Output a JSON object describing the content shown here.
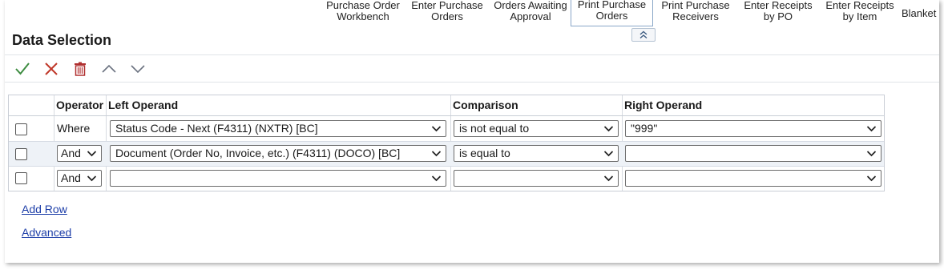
{
  "tabs": [
    {
      "label_line1": "Purchase Order",
      "label_line2": "Workbench",
      "active": false
    },
    {
      "label_line1": "Enter Purchase",
      "label_line2": "Orders",
      "active": false
    },
    {
      "label_line1": "Orders Awaiting",
      "label_line2": "Approval",
      "active": false
    },
    {
      "label_line1": "Print Purchase",
      "label_line2": "Orders",
      "active": true
    },
    {
      "label_line1": "Print Purchase",
      "label_line2": "Receivers",
      "active": false
    },
    {
      "label_line1": "Enter Receipts",
      "label_line2": "by PO",
      "active": false
    },
    {
      "label_line1": "Enter Receipts",
      "label_line2": "by Item",
      "active": false
    },
    {
      "label_line1": "Blanket",
      "label_line2": "",
      "active": false
    }
  ],
  "page_title": "Data Selection",
  "toolbar": {
    "ok_icon": "checkmark-icon",
    "cancel_icon": "x-icon",
    "delete_icon": "trash-icon",
    "move_up_icon": "chevron-up-icon",
    "move_down_icon": "chevron-down-icon"
  },
  "grid": {
    "headers": {
      "operator": "Operator",
      "left_operand": "Left Operand",
      "comparison": "Comparison",
      "right_operand": "Right Operand"
    },
    "rows": [
      {
        "operator": "Where",
        "left_operand": "Status Code - Next (F4311) (NXTR) [BC]",
        "comparison": "is not equal to",
        "right_operand": "\"999\""
      },
      {
        "operator": "And",
        "left_operand": "Document (Order No, Invoice, etc.) (F4311) (DOCO) [BC]",
        "comparison": "is equal to",
        "right_operand": ""
      },
      {
        "operator": "And",
        "left_operand": "",
        "comparison": "",
        "right_operand": ""
      }
    ]
  },
  "links": {
    "add_row": "Add Row",
    "advanced": "Advanced"
  },
  "colors": {
    "ok_green": "#3d8c40",
    "cancel_red": "#c0392b",
    "delete_red": "#b03030",
    "link_blue": "#1d3ea8",
    "active_tab_border": "#8aa7c8"
  }
}
